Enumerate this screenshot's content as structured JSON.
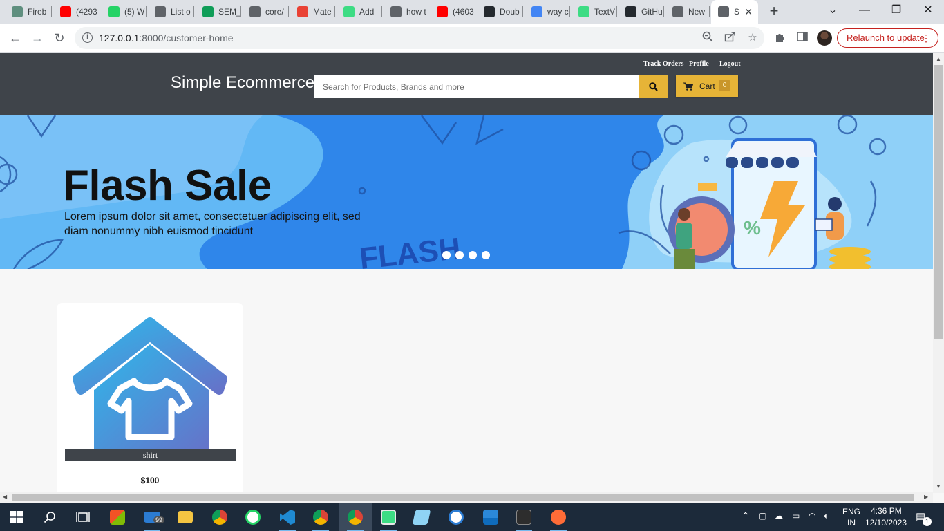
{
  "browser": {
    "tabs": [
      {
        "label": "Fireb",
        "icon": "openai-icon",
        "color": "#5f8f7f"
      },
      {
        "label": "(4293",
        "icon": "youtube-icon",
        "color": "#ff0000"
      },
      {
        "label": "(5) W",
        "icon": "whatsapp-icon",
        "color": "#25d366"
      },
      {
        "label": "List o",
        "icon": "globe-icon",
        "color": "#5f6368"
      },
      {
        "label": "SEM_",
        "icon": "sheets-icon",
        "color": "#0f9d58"
      },
      {
        "label": "core/",
        "icon": "globe-icon",
        "color": "#5f6368"
      },
      {
        "label": "Mate",
        "icon": "material-icon",
        "color": "#e94235"
      },
      {
        "label": "Add",
        "icon": "android-icon",
        "color": "#3ddc84"
      },
      {
        "label": "how t",
        "icon": "globe-icon",
        "color": "#5f6368"
      },
      {
        "label": "(4603",
        "icon": "youtube-icon",
        "color": "#ff0000"
      },
      {
        "label": "Doub",
        "icon": "github-icon",
        "color": "#24292e"
      },
      {
        "label": "way c",
        "icon": "google-icon",
        "color": "#4285f4"
      },
      {
        "label": "TextV",
        "icon": "android-icon",
        "color": "#3ddc84"
      },
      {
        "label": "GitHu",
        "icon": "github-icon",
        "color": "#24292e"
      },
      {
        "label": "New",
        "icon": "chrome-icon",
        "color": "#5f6368"
      },
      {
        "label": "S",
        "icon": "globe-icon",
        "color": "#5f6368",
        "active": true
      }
    ],
    "new_tab_label": "+",
    "address": {
      "host": "127.0.0.1",
      "rest": ":8000/customer-home"
    },
    "relaunch_label": "Relaunch to update"
  },
  "site": {
    "brand": "Simple Ecommerce",
    "links": {
      "track": "Track Orders",
      "profile": "Profile",
      "logout": "Logout"
    },
    "search_placeholder": "Search for Products, Brands and more",
    "cart_label": "Cart",
    "cart_count": "0"
  },
  "banner": {
    "title": "Flash Sale",
    "subtitle": "Lorem ipsum dolor sit amet, consectetuer adipiscing elit, sed diam nonummy nibh euismod tincidunt",
    "decor_text": "FLASH",
    "slide_count": 4,
    "colors": {
      "bg": "#62b8f5",
      "wave": "#2f86ea"
    }
  },
  "products": [
    {
      "name": "shirt",
      "price": "$100"
    }
  ],
  "colors": {
    "header": "#3f444a",
    "accent": "#e6b437"
  },
  "taskbar": {
    "mail_badge": "99",
    "language_top": "ENG",
    "language_bottom": "IN",
    "time": "4:36 PM",
    "date": "12/10/2023",
    "notification_count": "1"
  }
}
